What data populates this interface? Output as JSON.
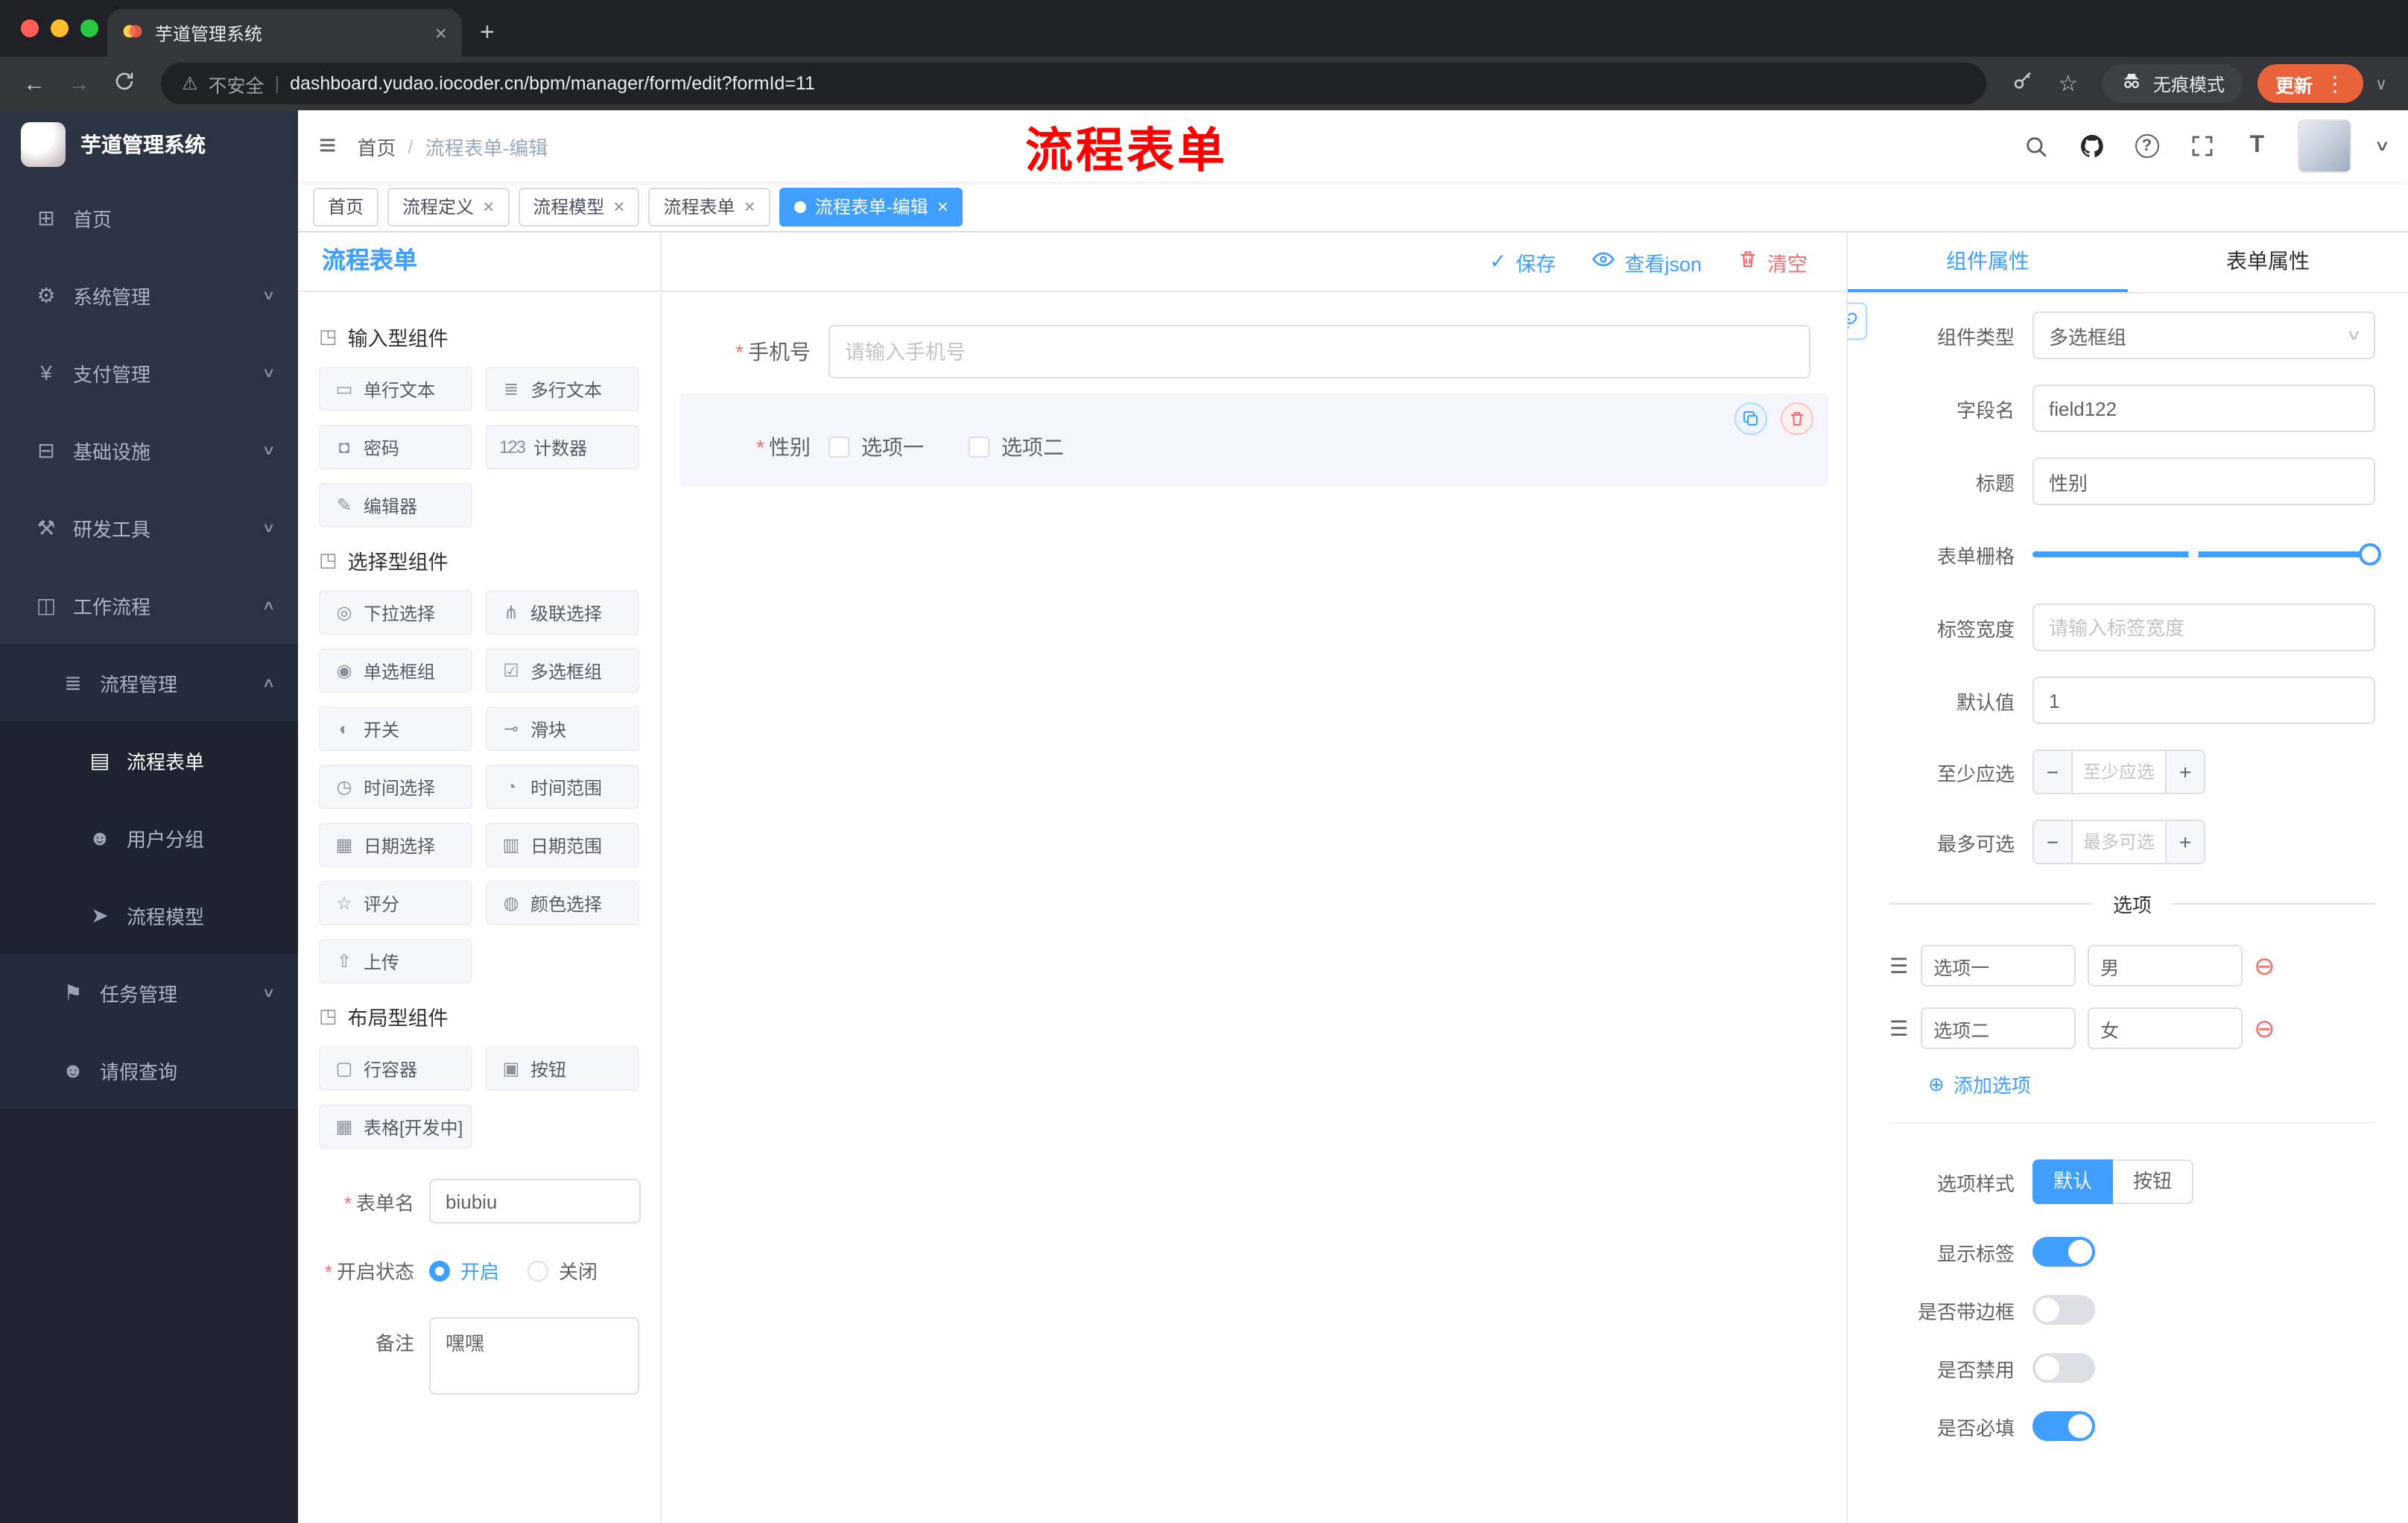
{
  "colors": {
    "accent": "#409eff",
    "danger": "#f56c6c",
    "annotation": "#ff0000",
    "update_button": "#e8623c"
  },
  "browser": {
    "tab_title": "芋道管理系统",
    "security_label": "不安全",
    "url": "dashboard.yudao.iocoder.cn/bpm/manager/form/edit?formId=11",
    "incognito_label": "无痕模式",
    "update_label": "更新"
  },
  "annotation": "流程表单",
  "header": {
    "breadcrumb": [
      "首页",
      "流程表单-编辑"
    ]
  },
  "tags": [
    {
      "label": "首页",
      "closable": false,
      "active": false
    },
    {
      "label": "流程定义",
      "closable": true,
      "active": false
    },
    {
      "label": "流程模型",
      "closable": true,
      "active": false
    },
    {
      "label": "流程表单",
      "closable": true,
      "active": false
    },
    {
      "label": "流程表单-编辑",
      "closable": true,
      "active": true
    }
  ],
  "sidebar": {
    "logo_title": "芋道管理系统",
    "items": [
      {
        "label": "首页",
        "icon": "home-icon",
        "level": 0
      },
      {
        "label": "系统管理",
        "icon": "gear-icon",
        "level": 0,
        "chevron": "down"
      },
      {
        "label": "支付管理",
        "icon": "money-icon",
        "level": 0,
        "chevron": "down"
      },
      {
        "label": "基础设施",
        "icon": "infrastructure-icon",
        "level": 0,
        "chevron": "down"
      },
      {
        "label": "研发工具",
        "icon": "devtools-icon",
        "level": 0,
        "chevron": "down"
      },
      {
        "label": "工作流程",
        "icon": "workflow-icon",
        "level": 0,
        "chevron": "up"
      },
      {
        "label": "流程管理",
        "icon": "process-management-icon",
        "level": 1,
        "chevron": "up"
      },
      {
        "label": "流程表单",
        "icon": "process-form-icon",
        "level": 2,
        "active": true
      },
      {
        "label": "用户分组",
        "icon": "user-group-icon",
        "level": 2
      },
      {
        "label": "流程模型",
        "icon": "process-model-icon",
        "level": 2
      },
      {
        "label": "任务管理",
        "icon": "task-management-icon",
        "level": 1,
        "chevron": "down"
      },
      {
        "label": "请假查询",
        "icon": "leave-query-icon",
        "level": 1
      }
    ]
  },
  "palette": {
    "title": "流程表单",
    "sections": [
      {
        "title": "输入型组件",
        "icon": "drag-cube-icon",
        "items": [
          {
            "label": "单行文本",
            "icon": "single-line-icon"
          },
          {
            "label": "多行文本",
            "icon": "multi-line-icon"
          },
          {
            "label": "密码",
            "icon": "password-icon"
          },
          {
            "label": "计数器",
            "icon": "counter-icon"
          },
          {
            "label": "编辑器",
            "icon": "editor-icon"
          }
        ]
      },
      {
        "title": "选择型组件",
        "icon": "drag-cube-icon",
        "items": [
          {
            "label": "下拉选择",
            "icon": "select-icon"
          },
          {
            "label": "级联选择",
            "icon": "cascader-icon"
          },
          {
            "label": "单选框组",
            "icon": "radio-icon"
          },
          {
            "label": "多选框组",
            "icon": "checkbox-icon"
          },
          {
            "label": "开关",
            "icon": "switch-icon"
          },
          {
            "label": "滑块",
            "icon": "slider-icon"
          },
          {
            "label": "时间选择",
            "icon": "time-icon"
          },
          {
            "label": "时间范围",
            "icon": "time-range-icon"
          },
          {
            "label": "日期选择",
            "icon": "date-icon"
          },
          {
            "label": "日期范围",
            "icon": "date-range-icon"
          },
          {
            "label": "评分",
            "icon": "rate-icon"
          },
          {
            "label": "颜色选择",
            "icon": "color-icon"
          },
          {
            "label": "上传",
            "icon": "upload-icon"
          }
        ]
      },
      {
        "title": "布局型组件",
        "icon": "drag-cube-icon",
        "items": [
          {
            "label": "行容器",
            "icon": "row-container-icon"
          },
          {
            "label": "按钮",
            "icon": "button-icon"
          },
          {
            "label": "表格[开发中]",
            "icon": "table-icon"
          }
        ]
      }
    ],
    "form": {
      "name_label": "表单名",
      "name_value": "biubiu",
      "status_label": "开启状态",
      "status_options": [
        "开启",
        "关闭"
      ],
      "status_selected": "开启",
      "remark_label": "备注",
      "remark_value": "嘿嘿"
    }
  },
  "toolbar": {
    "save": "保存",
    "view_json": "查看json",
    "clear": "清空"
  },
  "canvas": {
    "fields": [
      {
        "label": "手机号",
        "required": true,
        "type": "input",
        "placeholder": "请输入手机号"
      },
      {
        "label": "性别",
        "required": true,
        "type": "checkbox-group",
        "selected": true,
        "options": [
          "选项一",
          "选项二"
        ]
      }
    ]
  },
  "inspector": {
    "tabs": [
      "组件属性",
      "表单属性"
    ],
    "active_tab": "组件属性",
    "component_type_label": "组件类型",
    "component_type_value": "多选框组",
    "field_name_label": "字段名",
    "field_name_value": "field122",
    "title_label": "标题",
    "title_value": "性别",
    "grid_label": "表单栅格",
    "label_width_label": "标签宽度",
    "label_width_placeholder": "请输入标签宽度",
    "default_label": "默认值",
    "default_value": "1",
    "min_label": "至少应选",
    "min_placeholder": "至少应选",
    "max_label": "最多可选",
    "max_placeholder": "最多可选",
    "options_divider": "选项",
    "option_rows": [
      {
        "label": "选项一",
        "value": "男"
      },
      {
        "label": "选项二",
        "value": "女"
      }
    ],
    "add_option": "添加选项",
    "style_label": "选项样式",
    "style_options": [
      "默认",
      "按钮"
    ],
    "style_selected": "默认",
    "switches": [
      {
        "label": "显示标签",
        "on": true
      },
      {
        "label": "是否带边框",
        "on": false
      },
      {
        "label": "是否禁用",
        "on": false
      },
      {
        "label": "是否必填",
        "on": true
      }
    ]
  },
  "icons": {
    "home-icon": "⊞",
    "gear-icon": "⚙",
    "money-icon": "¥",
    "infrastructure-icon": "⊟",
    "devtools-icon": "⚒",
    "workflow-icon": "◫",
    "process-management-icon": "≣",
    "process-form-icon": "▤",
    "user-group-icon": "☻",
    "process-model-icon": "➤",
    "task-management-icon": "⚑",
    "leave-query-icon": "☻",
    "drag-cube-icon": "◳",
    "single-line-icon": "▭",
    "multi-line-icon": "≣",
    "password-icon": "◘",
    "counter-icon": "123",
    "editor-icon": "✎",
    "select-icon": "◎",
    "cascader-icon": "⋔",
    "radio-icon": "◉",
    "checkbox-icon": "☑",
    "switch-icon": "◐",
    "slider-icon": "⊸",
    "time-icon": "◷",
    "time-range-icon": "◔",
    "date-icon": "▦",
    "date-range-icon": "▥",
    "rate-icon": "☆",
    "color-icon": "◍",
    "upload-icon": "⇧",
    "row-container-icon": "▢",
    "button-icon": "▣",
    "table-icon": "▦",
    "close-icon": "×",
    "plus-icon": "+",
    "minus-icon": "−",
    "add-icon": "⊕",
    "remove-icon": "⊖",
    "drag-handle-icon": "☰",
    "check-icon": "✓",
    "warning-icon": "⚠",
    "back-icon": "←",
    "forward-icon": "→",
    "star-icon": "☆",
    "dot-menu-icon": "⋮",
    "chevron-small": "∨",
    "hamburger-icon": "≡",
    "breadcrumb-separator": "/",
    "divider-bar": "|",
    "question-mark": "?",
    "font-size-icon": "T",
    "required-asterisk": "*"
  }
}
